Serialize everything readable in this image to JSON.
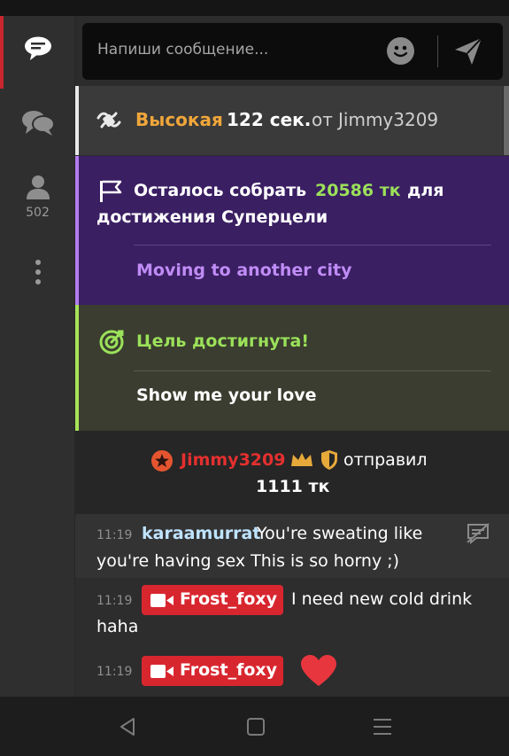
{
  "nav": {
    "user_count": "502"
  },
  "input": {
    "placeholder": "Напиши сообщение..."
  },
  "spin": {
    "level": "Высокая",
    "duration": "122 сек.",
    "from": "от",
    "user": "Jimmy3209"
  },
  "goal": {
    "line1_prefix": "Осталось собрать",
    "amount": "20586 тк",
    "line1_suffix": "для",
    "line2": "достижения Суперцели",
    "goal_name": "Moving to another city"
  },
  "goal_reached": {
    "title": "Цель достигнута!",
    "name": "Show me your love"
  },
  "tip": {
    "user": "Jimmy3209",
    "action": "отправил",
    "amount": "1111 тк"
  },
  "messages": [
    {
      "time": "11:19",
      "user": "karaamurrat",
      "text_line1": "You're sweating like",
      "text_line2": "you're having sex This is so horny ;)"
    },
    {
      "time": "11:19",
      "user": "Frost_foxy",
      "text_line1": "I need new cold drink",
      "text_line2": "haha"
    },
    {
      "time": "11:19",
      "user": "Frost_foxy"
    }
  ],
  "colors": {
    "accent_red": "#d8262f",
    "spin_orange": "#f0a63a",
    "goal_green": "#9be15a",
    "goal_purple": "#c08cf5",
    "username_blue": "#bfe3ff",
    "tip_red": "#e4302f",
    "gold": "#e6a93a"
  }
}
